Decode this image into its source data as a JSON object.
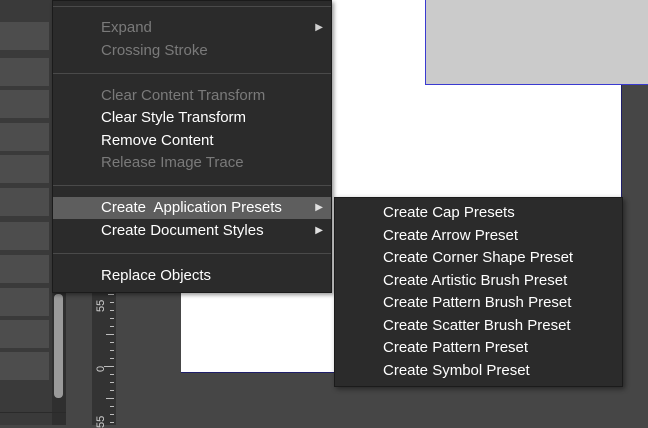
{
  "context_menu": {
    "items": [
      {
        "label": "Expand",
        "disabled": true,
        "has_submenu": true
      },
      {
        "label": "Crossing Stroke",
        "disabled": true
      },
      {
        "label": "Clear Content Transform",
        "disabled": true
      },
      {
        "label": "Clear Style Transform",
        "disabled": false
      },
      {
        "label": "Remove Content",
        "disabled": false
      },
      {
        "label": "Release Image Trace",
        "disabled": true
      },
      {
        "label": "Create  Application Presets",
        "disabled": false,
        "has_submenu": true,
        "highlighted": true
      },
      {
        "label": "Create Document Styles",
        "disabled": false,
        "has_submenu": true
      },
      {
        "label": "Replace Objects",
        "disabled": false
      }
    ],
    "submenu_arrow": "▶"
  },
  "submenu": {
    "items": [
      "Create Cap Presets",
      "Create Arrow Preset",
      "Create Corner Shape Preset",
      "Create Artistic Brush Preset",
      "Create Pattern Brush Preset",
      "Create Scatter Brush Preset",
      "Create Pattern Preset",
      "Create Symbol Preset"
    ]
  },
  "ruler": {
    "labels": [
      "55",
      "0",
      "55"
    ]
  },
  "colors": {
    "menu_bg": "#2b2b2b",
    "highlight": "#5e5e5e",
    "disabled_text": "#7a7a7a",
    "artboard_border": "#1f1f6a"
  }
}
